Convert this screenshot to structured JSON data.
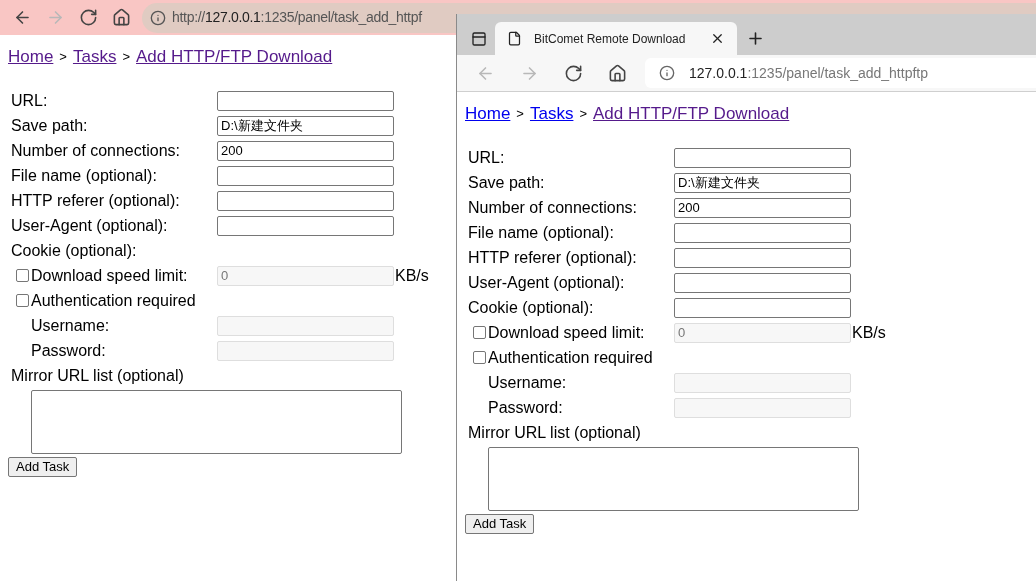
{
  "back_window": {
    "nav": [
      {
        "kind": "back",
        "disabled": false
      },
      {
        "kind": "forward",
        "disabled": true
      },
      {
        "kind": "reload",
        "disabled": false
      },
      {
        "kind": "home",
        "disabled": false
      }
    ],
    "address": {
      "scheme": "http://",
      "host": "127.0.0.1",
      "path": ":1235/panel/task_add_httpf"
    },
    "breadcrumb": [
      {
        "label": "Home",
        "visited": true
      },
      {
        "label": "Tasks",
        "visited": true
      },
      {
        "label": "Add HTTP/FTP Download",
        "visited": true
      }
    ],
    "separators": [
      ">",
      ">"
    ],
    "rows": [
      {
        "kind": "field",
        "label": "URL:",
        "disabled": false
      },
      {
        "kind": "field",
        "label": "Save path:",
        "value": "D:\\新建文件夹",
        "disabled": false
      },
      {
        "kind": "field",
        "label": "Number of connections:",
        "value": "200",
        "disabled": false
      },
      {
        "kind": "field",
        "label": "File name (optional):",
        "disabled": false
      },
      {
        "kind": "field",
        "label": "HTTP referer (optional):",
        "disabled": false
      },
      {
        "kind": "field",
        "label": "User-Agent (optional):",
        "disabled": false
      },
      {
        "kind": "label",
        "label": "Cookie (optional):"
      },
      {
        "kind": "check",
        "label": "Download speed limit:",
        "checked": false,
        "value": "0",
        "disabled": true,
        "unit": "KB/s"
      },
      {
        "kind": "check",
        "label": "Authentication required",
        "checked": false
      },
      {
        "kind": "sub",
        "label": "Username:",
        "disabled": true
      },
      {
        "kind": "sub",
        "label": "Password:",
        "disabled": true
      },
      {
        "kind": "label",
        "label": "Mirror URL list (optional)"
      },
      {
        "kind": "textarea"
      }
    ],
    "submit": "Add Task"
  },
  "front_window": {
    "tab": {
      "title": "BitComet Remote Download"
    },
    "nav": [
      {
        "kind": "back",
        "disabled": true
      },
      {
        "kind": "forward",
        "disabled": true
      },
      {
        "kind": "reload",
        "disabled": false
      },
      {
        "kind": "home",
        "disabled": false
      }
    ],
    "address": {
      "host": "127.0.0.1",
      "path": ":1235/panel/task_add_httpftp"
    },
    "breadcrumb": [
      {
        "label": "Home",
        "visited": false
      },
      {
        "label": "Tasks",
        "visited": false
      },
      {
        "label": "Add HTTP/FTP Download",
        "visited": true
      }
    ],
    "separators": [
      ">",
      ">"
    ],
    "rows": [
      {
        "kind": "field",
        "label": "URL:",
        "disabled": false
      },
      {
        "kind": "field",
        "label": "Save path:",
        "value": "D:\\新建文件夹",
        "disabled": false
      },
      {
        "kind": "field",
        "label": "Number of connections:",
        "value": "200",
        "disabled": false
      },
      {
        "kind": "field",
        "label": "File name (optional):",
        "disabled": false
      },
      {
        "kind": "field",
        "label": "HTTP referer (optional):",
        "disabled": false
      },
      {
        "kind": "field",
        "label": "User-Agent (optional):",
        "disabled": false
      },
      {
        "kind": "field",
        "label": "Cookie (optional):",
        "disabled": false
      },
      {
        "kind": "check",
        "label": "Download speed limit:",
        "checked": false,
        "value": "0",
        "disabled": true,
        "unit": "KB/s"
      },
      {
        "kind": "check",
        "label": "Authentication required",
        "checked": false
      },
      {
        "kind": "sub",
        "label": "Username:",
        "disabled": true
      },
      {
        "kind": "sub",
        "label": "Password:",
        "disabled": true
      },
      {
        "kind": "label",
        "label": "Mirror URL list (optional)"
      },
      {
        "kind": "textarea"
      }
    ],
    "submit": "Add Task"
  }
}
